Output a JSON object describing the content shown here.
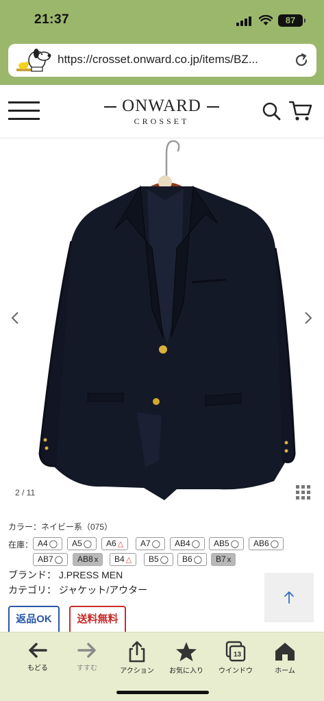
{
  "status": {
    "time": "21:37",
    "battery": "87"
  },
  "browser": {
    "url": "https://crosset.onward.co.jp/items/BZ..."
  },
  "header": {
    "logo_main": "ONWARD",
    "logo_sub": "CROSSET"
  },
  "gallery": {
    "counter": "2 / 11"
  },
  "product": {
    "color_line": "カラー：ネイビー系（075）",
    "stock_label": "在庫：",
    "sizes": [
      {
        "label": "A4",
        "mark": "◯"
      },
      {
        "label": "A5",
        "mark": "◯"
      },
      {
        "label": "A6",
        "mark": "△"
      },
      {
        "label": "A7",
        "mark": "◯"
      },
      {
        "label": "AB4",
        "mark": "◯"
      },
      {
        "label": "AB5",
        "mark": "◯"
      },
      {
        "label": "AB6",
        "mark": "◯"
      },
      {
        "label": "AB7",
        "mark": "◯"
      },
      {
        "label": "AB8",
        "mark": "x"
      },
      {
        "label": "B4",
        "mark": "△"
      },
      {
        "label": "B5",
        "mark": "◯"
      },
      {
        "label": "B6",
        "mark": "◯"
      },
      {
        "label": "B7",
        "mark": "x"
      }
    ],
    "brand_line": "ブランド： J.PRESS MEN",
    "category_line": "カテゴリ： ジャケット/アウター",
    "badges": {
      "returns": "返品OK",
      "shipping": "送料無料"
    }
  },
  "toolbar": {
    "back": "もどる",
    "forward": "すすむ",
    "action": "アクション",
    "bookmarks": "お気に入り",
    "tabs": "ウインドウ",
    "tabs_count": "13",
    "home": "ホーム"
  },
  "colors": {
    "chrome_green": "#9ab76b",
    "toolbar_bg": "#e8edcf",
    "returns_blue": "#2a56a8",
    "shipping_red": "#c92a2a",
    "jacket_navy": "#141927"
  }
}
